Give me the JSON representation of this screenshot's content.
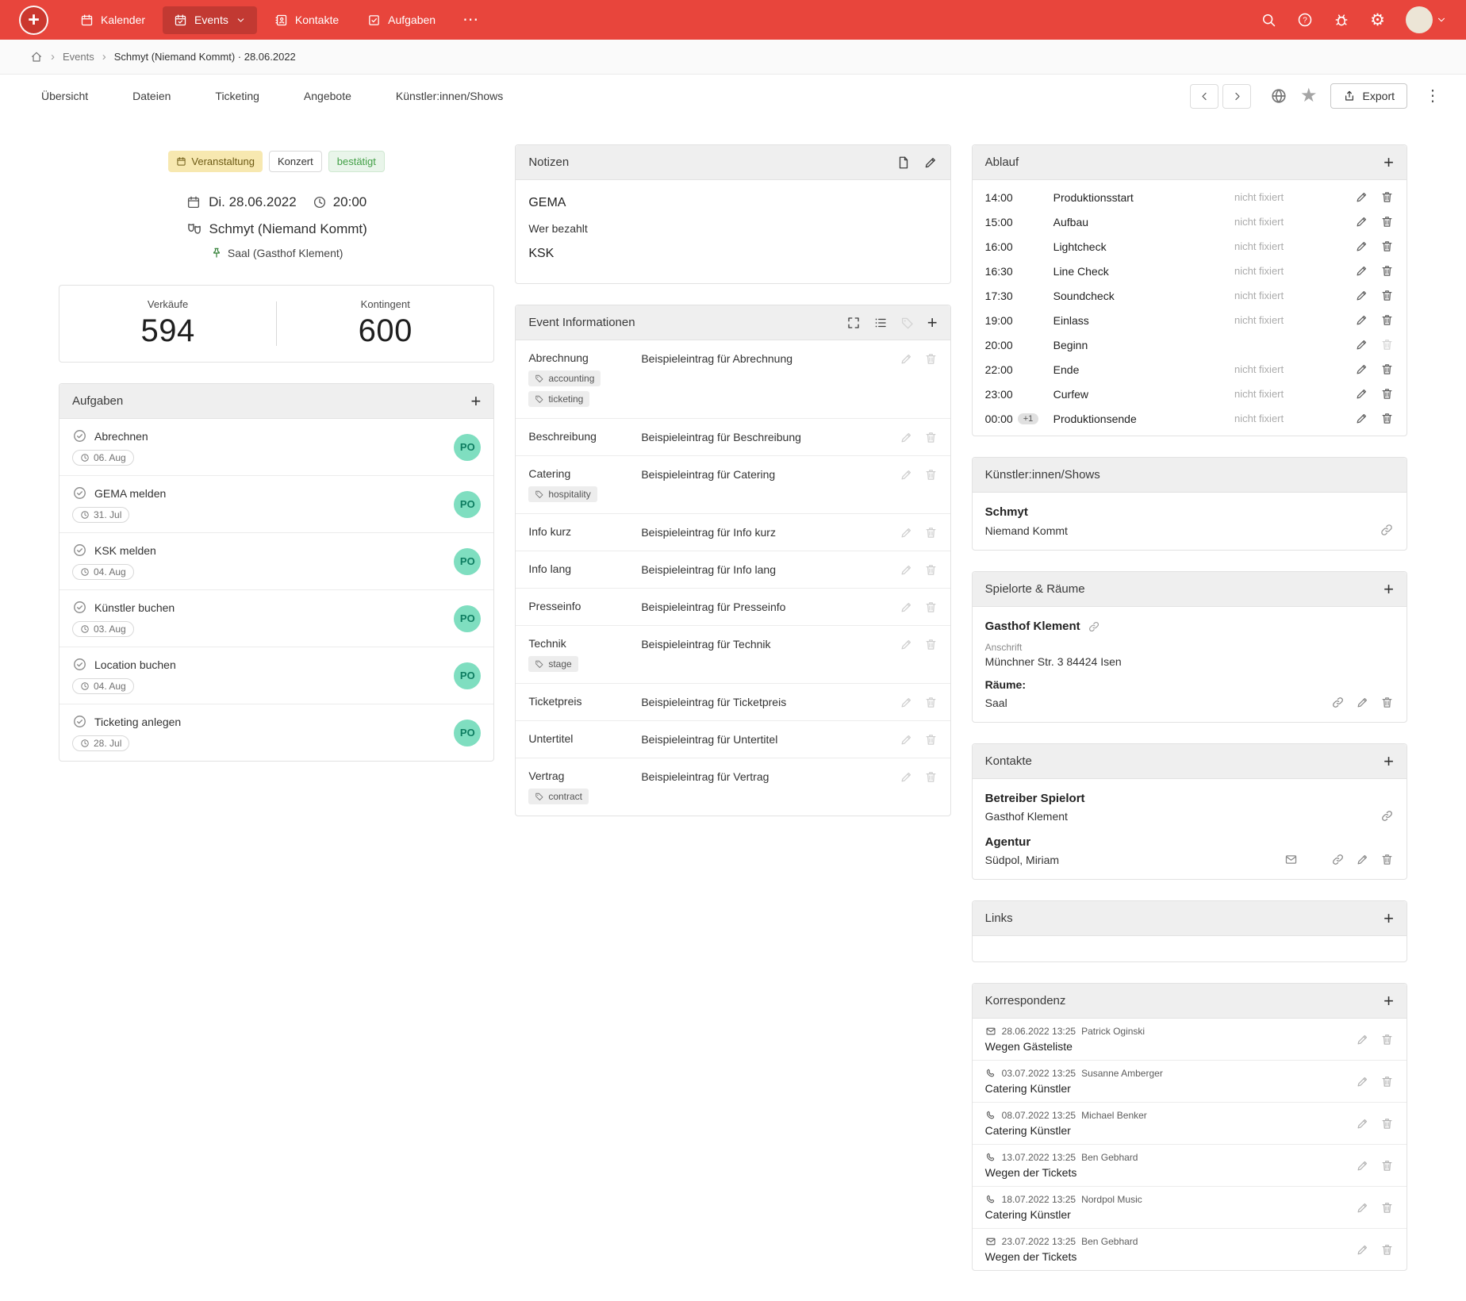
{
  "colors": {
    "topbar": "#e8453c",
    "confirmed_green": "#43a047",
    "assignee_green": "#7fdec0",
    "badge_yellow": "#f7e8b0"
  },
  "icons": {
    "plus": "+",
    "ellipsis": "⋯",
    "gear": "⚙",
    "star": "★",
    "kebab": "⋮",
    "breadcrumb_sep": "›"
  },
  "topbar": {
    "nav": [
      {
        "label": "Kalender"
      },
      {
        "label": "Events"
      },
      {
        "label": "Kontakte"
      },
      {
        "label": "Aufgaben"
      }
    ]
  },
  "breadcrumb": {
    "parent": "Events",
    "current": "Schmyt (Niemand Kommt) · 28.06.2022"
  },
  "tabs": {
    "items": [
      "Übersicht",
      "Dateien",
      "Ticketing",
      "Angebote",
      "Künstler:innen/Shows"
    ],
    "export_label": "Export"
  },
  "event_header": {
    "badges": [
      {
        "label": "Veranstaltung"
      },
      {
        "label": "Konzert"
      },
      {
        "label": "bestätigt"
      }
    ],
    "date": "Di. 28.06.2022",
    "time": "20:00",
    "title": "Schmyt (Niemand Kommt)",
    "location": "Saal (Gasthof Klement)"
  },
  "stats": {
    "sales_label": "Verkäufe",
    "sales_value": "594",
    "quota_label": "Kontingent",
    "quota_value": "600"
  },
  "tasks": {
    "title": "Aufgaben",
    "items": [
      {
        "label": "Abrechnen",
        "date": "06. Aug",
        "assignee": "PO"
      },
      {
        "label": "GEMA melden",
        "date": "31. Jul",
        "assignee": "PO"
      },
      {
        "label": "KSK melden",
        "date": "04. Aug",
        "assignee": "PO"
      },
      {
        "label": "Künstler buchen",
        "date": "03. Aug",
        "assignee": "PO"
      },
      {
        "label": "Location buchen",
        "date": "04. Aug",
        "assignee": "PO"
      },
      {
        "label": "Ticketing anlegen",
        "date": "28. Jul",
        "assignee": "PO"
      }
    ]
  },
  "notes": {
    "title": "Notizen",
    "lines": [
      "GEMA",
      "Wer bezahlt",
      "KSK"
    ]
  },
  "event_info": {
    "title": "Event Informationen",
    "rows": [
      {
        "label": "Abrechnung",
        "value": "Beispieleintrag für Abrechnung",
        "tags": [
          "accounting",
          "ticketing"
        ]
      },
      {
        "label": "Beschreibung",
        "value": "Beispieleintrag für Beschreibung",
        "tags": []
      },
      {
        "label": "Catering",
        "value": "Beispieleintrag für Catering",
        "tags": [
          "hospitality"
        ]
      },
      {
        "label": "Info kurz",
        "value": "Beispieleintrag für Info kurz",
        "tags": []
      },
      {
        "label": "Info lang",
        "value": "Beispieleintrag für Info lang",
        "tags": []
      },
      {
        "label": "Presseinfo",
        "value": "Beispieleintrag für Presseinfo",
        "tags": []
      },
      {
        "label": "Technik",
        "value": "Beispieleintrag für Technik",
        "tags": [
          "stage"
        ]
      },
      {
        "label": "Ticketpreis",
        "value": "Beispieleintrag für Ticketpreis",
        "tags": []
      },
      {
        "label": "Untertitel",
        "value": "Beispieleintrag für Untertitel",
        "tags": []
      },
      {
        "label": "Vertrag",
        "value": "Beispieleintrag für Vertrag",
        "tags": [
          "contract"
        ]
      }
    ]
  },
  "schedule": {
    "title": "Ablauf",
    "items": [
      {
        "time": "14:00",
        "label": "Produktionsstart",
        "status": "nicht fixiert"
      },
      {
        "time": "15:00",
        "label": "Aufbau",
        "status": "nicht fixiert"
      },
      {
        "time": "16:00",
        "label": "Lightcheck",
        "status": "nicht fixiert"
      },
      {
        "time": "16:30",
        "label": "Line Check",
        "status": "nicht fixiert"
      },
      {
        "time": "17:30",
        "label": "Soundcheck",
        "status": "nicht fixiert"
      },
      {
        "time": "19:00",
        "label": "Einlass",
        "status": "nicht fixiert"
      },
      {
        "time": "20:00",
        "label": "Beginn",
        "status": "",
        "no_delete": true
      },
      {
        "time": "22:00",
        "label": "Ende",
        "status": "nicht fixiert"
      },
      {
        "time": "23:00",
        "label": "Curfew",
        "status": "nicht fixiert"
      },
      {
        "time": "00:00",
        "plus": "+1",
        "label": "Produktionsende",
        "status": "nicht fixiert"
      }
    ]
  },
  "artists": {
    "title": "Künstler:innen/Shows",
    "name": "Schmyt",
    "show": "Niemand Kommt"
  },
  "venues": {
    "title": "Spielorte & Räume",
    "venue_name": "Gasthof Klement",
    "address_label": "Anschrift",
    "address": "Münchner Str. 3 84424 Isen",
    "rooms_label": "Räume:",
    "room": "Saal"
  },
  "contacts": {
    "title": "Kontakte",
    "items": [
      {
        "role": "Betreiber Spielort",
        "name": "Gasthof Klement"
      },
      {
        "role": "Agentur",
        "name": "Südpol, Miriam"
      }
    ]
  },
  "links": {
    "title": "Links"
  },
  "correspondence": {
    "title": "Korrespondenz",
    "items": [
      {
        "channel": "mail",
        "datetime": "28.06.2022 13:25",
        "person": "Patrick Oginski",
        "subject": "Wegen Gästeliste"
      },
      {
        "channel": "phone",
        "datetime": "03.07.2022 13:25",
        "person": "Susanne Amberger",
        "subject": "Catering Künstler"
      },
      {
        "channel": "phone",
        "datetime": "08.07.2022 13:25",
        "person": "Michael Benker",
        "subject": "Catering Künstler"
      },
      {
        "channel": "phone",
        "datetime": "13.07.2022 13:25",
        "person": "Ben Gebhard",
        "subject": "Wegen der Tickets"
      },
      {
        "channel": "phone",
        "datetime": "18.07.2022 13:25",
        "person": "Nordpol Music",
        "subject": "Catering Künstler"
      },
      {
        "channel": "mail",
        "datetime": "23.07.2022 13:25",
        "person": "Ben Gebhard",
        "subject": "Wegen der Tickets"
      }
    ]
  }
}
